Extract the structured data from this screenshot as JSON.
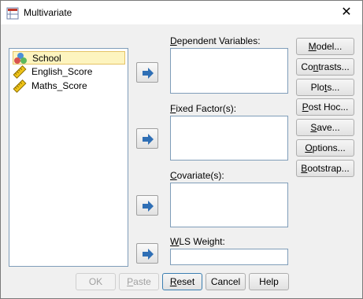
{
  "window": {
    "title": "Multivariate",
    "close_glyph": "✕"
  },
  "variables": [
    {
      "label": "School",
      "icon": "nominal-icon",
      "selected": true
    },
    {
      "label": "English_Score",
      "icon": "scale-ruler-icon",
      "selected": false
    },
    {
      "label": "Maths_Score",
      "icon": "scale-ruler-icon",
      "selected": false
    }
  ],
  "fields": {
    "dependent": {
      "label_u": "D",
      "label_rest": "ependent Variables:"
    },
    "fixed": {
      "label_u": "F",
      "label_rest": "ixed Factor(s):"
    },
    "covariate": {
      "label_u": "C",
      "label_rest": "ovariate(s):"
    },
    "wls": {
      "label_u": "W",
      "label_rest": "LS Weight:"
    }
  },
  "right_buttons": [
    {
      "pre": "",
      "u": "M",
      "post": "odel..."
    },
    {
      "pre": "Co",
      "u": "n",
      "post": "trasts..."
    },
    {
      "pre": "Plo",
      "u": "t",
      "post": "s..."
    },
    {
      "pre": "",
      "u": "P",
      "post": "ost Hoc..."
    },
    {
      "pre": "",
      "u": "S",
      "post": "ave..."
    },
    {
      "pre": "",
      "u": "O",
      "post": "ptions..."
    },
    {
      "pre": "",
      "u": "B",
      "post": "ootstrap..."
    }
  ],
  "bottom_buttons": {
    "ok": "OK",
    "paste_u": "P",
    "paste_rest": "aste",
    "reset_u": "R",
    "reset_rest": "eset",
    "cancel": "Cancel",
    "help": "Help"
  },
  "colors": {
    "selection_bg": "#fdf4bf",
    "arrow_blue": "#2f6fb5"
  }
}
